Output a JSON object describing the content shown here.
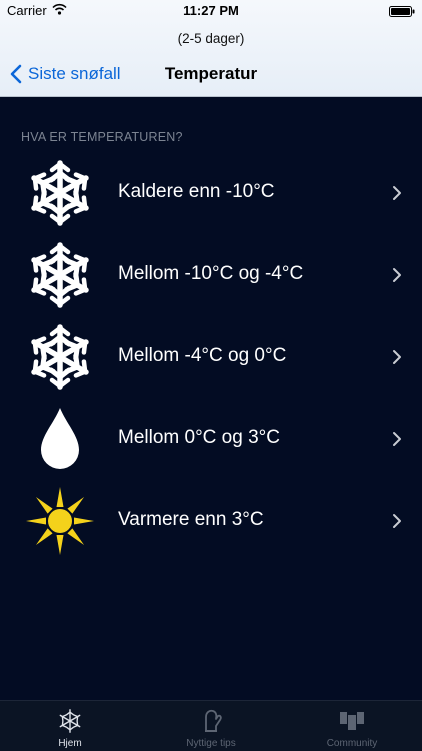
{
  "status_bar": {
    "carrier": "Carrier",
    "time": "11:27 PM"
  },
  "nav": {
    "prompt": "(2-5 dager)",
    "back_label": "Siste snøfall",
    "title": "Temperatur"
  },
  "section": {
    "header": "HVA ER TEMPERATUREN?"
  },
  "options": [
    {
      "label": "Kaldere enn -10°C",
      "icon": "snowflake-icon"
    },
    {
      "label": "Mellom -10°C og -4°C",
      "icon": "snowflake-icon"
    },
    {
      "label": "Mellom -4°C og 0°C",
      "icon": "snowflake-icon"
    },
    {
      "label": "Mellom 0°C og 3°C",
      "icon": "water-drop-icon"
    },
    {
      "label": "Varmere enn 3°C",
      "icon": "sun-icon"
    }
  ],
  "tabbar": {
    "tabs": [
      {
        "label": "Hjem",
        "icon": "snowflake-tab-icon",
        "active": true
      },
      {
        "label": "Nyttige tips",
        "icon": "mitten-icon",
        "active": false
      },
      {
        "label": "Community",
        "icon": "community-icon",
        "active": false
      }
    ]
  },
  "colors": {
    "background": "#030c23",
    "accent": "#0b66d8",
    "tab_active": "#dfe3ea",
    "tab_inactive": "#5d6573",
    "sun": "#f4d21b"
  }
}
